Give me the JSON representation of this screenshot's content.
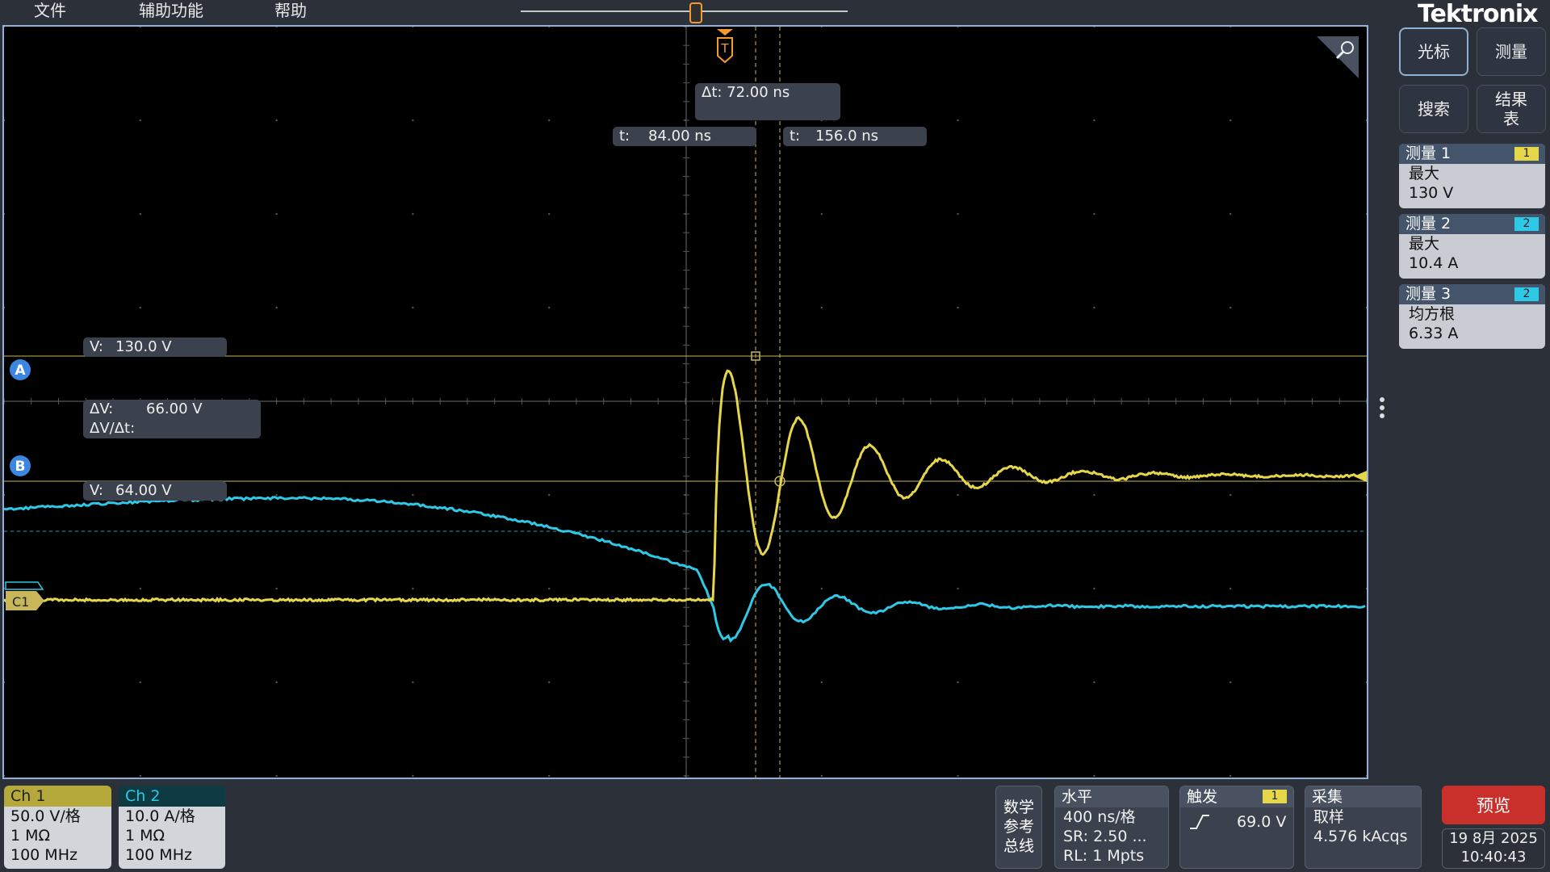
{
  "menu": {
    "file": "文件",
    "tools": "辅助功能",
    "help": "帮助"
  },
  "brand": "Tektronix",
  "cursors": {
    "dt": "Δt:  72.00 ns",
    "t1_label": "t:",
    "t1_value": "84.00 ns",
    "t2_label": "t:",
    "t2_value": "156.0 ns",
    "va_label": "V:",
    "va_value": "130.0 V",
    "vb_label": "V:",
    "vb_value": "64.00 V",
    "dv_label": "ΔV:",
    "dv_value": "66.00 V",
    "dvdt_label": "ΔV/Δt:",
    "marker_a": "A",
    "marker_b": "B"
  },
  "trigger_marker": "T",
  "channel_marker": "C1",
  "side": {
    "cursor_btn": "光标",
    "measure_btn": "测量",
    "search_btn": "搜索",
    "results_btn_l1": "结果",
    "results_btn_l2": "表"
  },
  "measurements": [
    {
      "title": "测量 1",
      "badge": "1",
      "type": "最大",
      "value": "130 V",
      "badge_color": "#e5d64a"
    },
    {
      "title": "测量 2",
      "badge": "2",
      "type": "最大",
      "value": "10.4 A",
      "badge_color": "#2ec9e6"
    },
    {
      "title": "测量 3",
      "badge": "2",
      "type": "均方根",
      "value": "6.33 A",
      "badge_color": "#2ec9e6"
    }
  ],
  "ch1": {
    "label": "Ch 1",
    "scale": "50.0 V/格",
    "impedance": "1 MΩ",
    "bw": "100 MHz",
    "color": "#e5d64a"
  },
  "ch2": {
    "label": "Ch 2",
    "scale": "10.0 A/格",
    "impedance": "1 MΩ",
    "bw": "100 MHz",
    "color": "#2ec9e6"
  },
  "math": {
    "l1": "数学",
    "l2": "参考",
    "l3": "总线"
  },
  "horizontal": {
    "title": "水平",
    "scale": "400 ns/格",
    "sr": "SR: 2.50 ...",
    "rl": "RL: 1 Mpts"
  },
  "trigger": {
    "title": "触发",
    "badge": "1",
    "level": "69.0 V"
  },
  "acquire": {
    "title": "采集",
    "mode": "取样",
    "count": "4.576 kAcqs"
  },
  "preview": "预览",
  "date": "19 8月 2025",
  "time": "10:40:43"
}
